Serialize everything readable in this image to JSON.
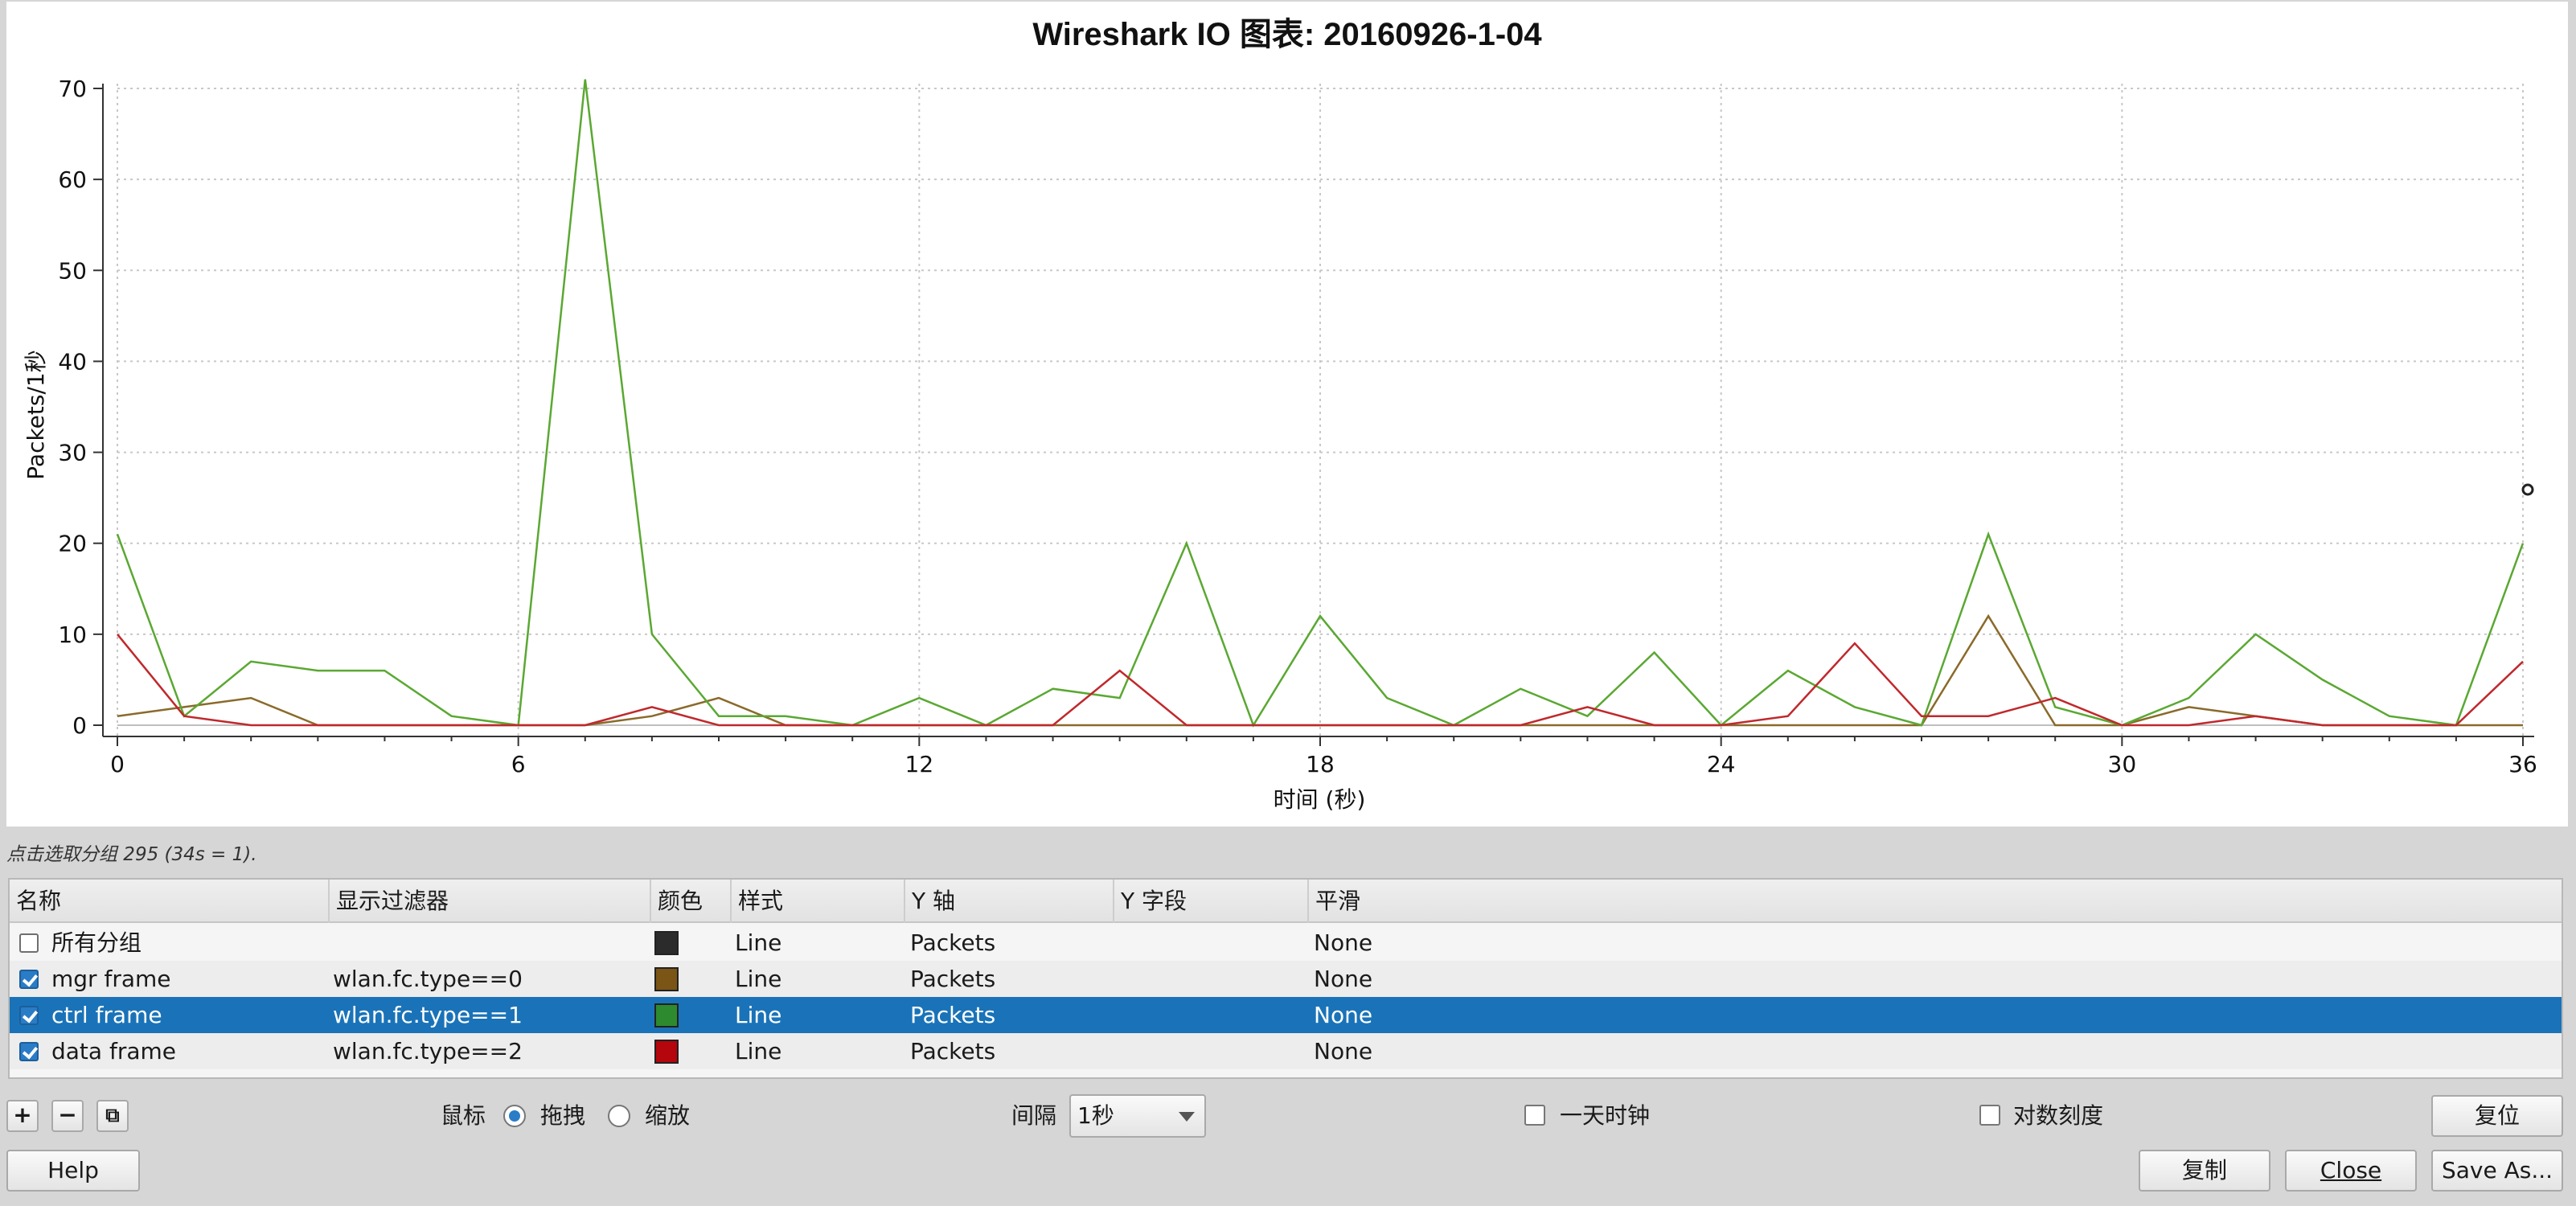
{
  "window": {
    "plot_title": "Wireshark IO 图表: 20160926-1-04"
  },
  "chart_data": {
    "type": "line",
    "title": "Wireshark IO 图表: 20160926-1-04",
    "xlabel": "时间 (秒)",
    "ylabel": "Packets/1秒",
    "xlim": [
      0,
      36
    ],
    "ylim": [
      0,
      70
    ],
    "x_ticks": [
      0,
      6,
      12,
      18,
      24,
      30,
      36
    ],
    "y_ticks": [
      0,
      10,
      20,
      30,
      40,
      50,
      60,
      70
    ],
    "grid": true,
    "x": [
      0,
      1,
      2,
      3,
      4,
      5,
      6,
      7,
      8,
      9,
      10,
      11,
      12,
      13,
      14,
      15,
      16,
      17,
      18,
      19,
      20,
      21,
      22,
      23,
      24,
      25,
      26,
      27,
      28,
      29,
      30,
      31,
      32,
      33,
      34,
      35,
      36
    ],
    "series": [
      {
        "name": "mgr frame",
        "color": "#8a6a2a",
        "values": [
          1,
          2,
          3,
          0,
          0,
          0,
          0,
          0,
          1,
          3,
          0,
          0,
          0,
          0,
          0,
          0,
          0,
          0,
          0,
          0,
          0,
          0,
          0,
          0,
          0,
          0,
          0,
          0,
          12,
          0,
          0,
          2,
          1,
          0,
          0,
          0,
          0
        ]
      },
      {
        "name": "ctrl frame",
        "color": "#5aa832",
        "values": [
          21,
          1,
          7,
          6,
          6,
          1,
          0,
          71,
          10,
          1,
          1,
          0,
          3,
          0,
          4,
          3,
          20,
          0,
          12,
          3,
          0,
          4,
          1,
          8,
          0,
          6,
          2,
          0,
          21,
          2,
          0,
          3,
          10,
          5,
          1,
          0,
          20
        ]
      },
      {
        "name": "data frame",
        "color": "#c0282c",
        "values": [
          10,
          1,
          0,
          0,
          0,
          0,
          0,
          0,
          2,
          0,
          0,
          0,
          0,
          0,
          0,
          6,
          0,
          0,
          0,
          0,
          0,
          0,
          2,
          0,
          0,
          1,
          9,
          1,
          1,
          3,
          0,
          0,
          1,
          0,
          0,
          0,
          7
        ]
      }
    ]
  },
  "status": {
    "text": "点击选取分组 295 (34s = 1)."
  },
  "table": {
    "headers": [
      "名称",
      "显示过滤器",
      "颜色",
      "样式",
      "Y 轴",
      "Y 字段",
      "平滑"
    ],
    "rows": [
      {
        "enabled": false,
        "name": "所有分组",
        "filter": "",
        "color": "#2b2b2b",
        "style": "Line",
        "yaxis": "Packets",
        "yfield": "",
        "smooth": "None"
      },
      {
        "enabled": true,
        "name": "mgr frame",
        "filter": "wlan.fc.type==0",
        "color": "#7a5516",
        "style": "Line",
        "yaxis": "Packets",
        "yfield": "",
        "smooth": "None"
      },
      {
        "enabled": true,
        "name": "ctrl frame",
        "filter": "wlan.fc.type==1",
        "color": "#2e8a2e",
        "style": "Line",
        "yaxis": "Packets",
        "yfield": "",
        "smooth": "None"
      },
      {
        "enabled": true,
        "name": "data frame",
        "filter": "wlan.fc.type==2",
        "color": "#b5050d",
        "style": "Line",
        "yaxis": "Packets",
        "yfield": "",
        "smooth": "None"
      }
    ]
  },
  "controls": {
    "add_label": "+",
    "remove_label": "−",
    "copy_graph_label": "⧉",
    "mouse_label": "鼠标",
    "drag_label": "拖拽",
    "zoom_label": "缩放",
    "interval_label": "间隔",
    "interval_value": "1秒",
    "time_of_day_label": "一天时钟",
    "log_scale_label": "对数刻度",
    "reset_label": "复位"
  },
  "buttons": {
    "help": "Help",
    "copy": "复制",
    "close": "Close",
    "save_as": "Save As..."
  }
}
